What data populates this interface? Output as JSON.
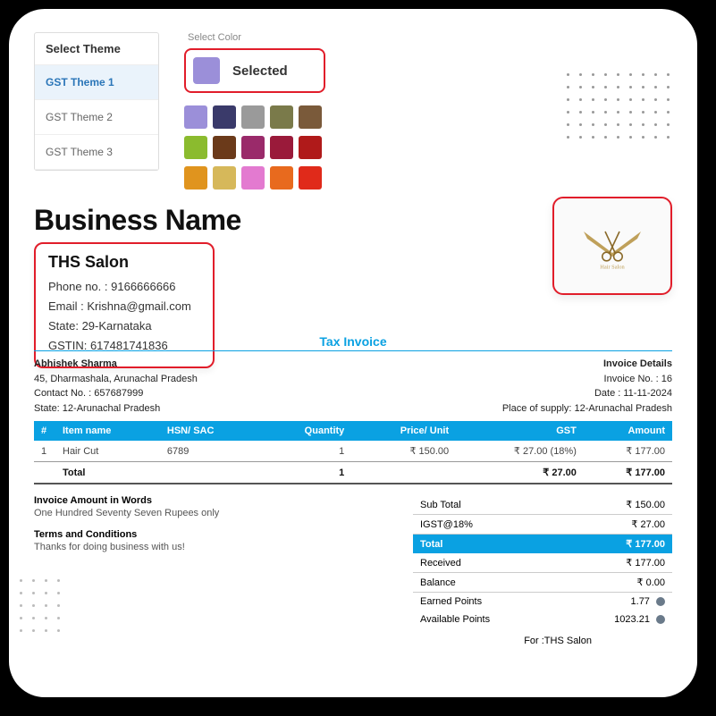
{
  "themePanel": {
    "heading": "Select Theme",
    "items": [
      "GST Theme 1",
      "GST Theme 2",
      "GST Theme 3"
    ]
  },
  "colorPanel": {
    "label": "Select Color",
    "selectedText": "Selected",
    "selectedColor": "#9b8fd9",
    "rows": [
      [
        "#9b8fd9",
        "#3a3a6a",
        "#9a9a9a",
        "#7a7a4a",
        "#7a5a3a"
      ],
      [
        "#8bbb2e",
        "#6b3a1a",
        "#9a2a6a",
        "#9a1a3a",
        "#b01a1a"
      ],
      [
        "#e0941e",
        "#d6b85a",
        "#e37ad0",
        "#e86a1e",
        "#e02a1a"
      ]
    ]
  },
  "business": {
    "heading": "Business Name",
    "name": "THS Salon",
    "phoneLabel": "Phone no. : ",
    "phone": "9166666666",
    "emailLabel": "Email : ",
    "email": "Krishna@gmail.com",
    "stateLabel": "State: ",
    "state": "29-Karnataka",
    "gstinLabel": "GSTIN: ",
    "gstin": "617481741836"
  },
  "invoice": {
    "title": "Tax Invoice",
    "billTo": {
      "name": "Abhishek Sharma",
      "addr": "45, Dharmashala, Arunachal Pradesh",
      "contactLabel": "Contact No. : ",
      "contact": "657687999",
      "stateLabel": "State: ",
      "state": "12-Arunachal Pradesh"
    },
    "details": {
      "heading": "Invoice Details",
      "noLabel": "Invoice No. : ",
      "no": "16",
      "dateLabel": "Date : ",
      "date": "11-11-2024",
      "posLabel": "Place of supply: ",
      "pos": "12-Arunachal Pradesh"
    },
    "headers": {
      "idx": "#",
      "name": "Item name",
      "hsn": "HSN/ SAC",
      "qty": "Quantity",
      "price": "Price/ Unit",
      "gst": "GST",
      "amount": "Amount"
    },
    "rows": [
      {
        "idx": "1",
        "name": "Hair Cut",
        "hsn": "6789",
        "qty": "1",
        "price": "₹ 150.00",
        "gst": "₹ 27.00 (18%)",
        "amount": "₹ 177.00"
      }
    ],
    "totalsRow": {
      "label": "Total",
      "qty": "1",
      "gst": "₹ 27.00",
      "amount": "₹ 177.00"
    },
    "wordsLabel": "Invoice Amount in Words",
    "words": "One Hundred Seventy Seven Rupees only",
    "termsLabel": "Terms and Conditions",
    "terms": "Thanks for doing business with us!",
    "summary": {
      "subtotal": {
        "k": "Sub Total",
        "v": "₹ 150.00"
      },
      "igst": {
        "k": "IGST@18%",
        "v": "₹ 27.00"
      },
      "total": {
        "k": "Total",
        "v": "₹ 177.00"
      },
      "received": {
        "k": "Received",
        "v": "₹ 177.00"
      },
      "balance": {
        "k": "Balance",
        "v": "₹ 0.00"
      },
      "earned": {
        "k": "Earned Points",
        "v": "1.77"
      },
      "available": {
        "k": "Available Points",
        "v": "1023.21"
      }
    },
    "forLine": "For :THS Salon"
  }
}
